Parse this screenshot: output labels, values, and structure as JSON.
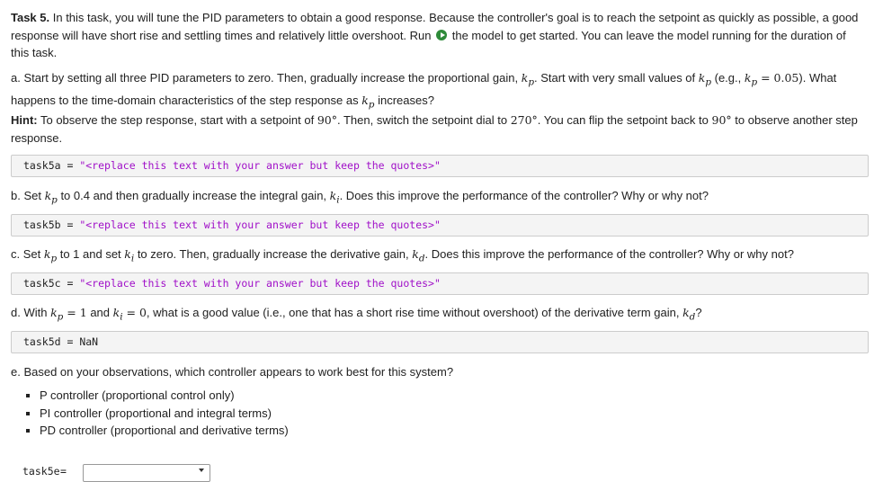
{
  "task": {
    "label": "Task 5.",
    "intro_1": " In this task, you will tune the PID parameters to obtain a good response. Because the controller's goal is to reach the setpoint as quickly as possible, a good response will have short rise and settling times and relatively little overshoot. Run ",
    "intro_2": " the model to get started. You can leave the model running for the duration of this task."
  },
  "part_a": {
    "t1": "a. Start by setting all three PID parameters to zero. Then, gradually increase the proportional gain, ",
    "t2": ". Start with very small values of ",
    "t3": " (e.g., ",
    "t4": "). What happens to the time-domain characteristics of the step response as ",
    "t5": " increases?",
    "kp_example": "k",
    "example_value": " = 0.05"
  },
  "hint": {
    "label": "Hint:",
    "t1": " To observe the step response, start with a setpoint of ",
    "setpoint_1": "90°",
    "t2": ". Then, switch the setpoint dial to ",
    "setpoint_2": "270°",
    "t3": ". You can flip the setpoint back to ",
    "setpoint_3": "90°",
    "t4": " to observe another step response."
  },
  "code_lines": {
    "task5a_name": "task5a",
    "task5a_value": "\"<replace this text with your answer but keep the quotes>\"",
    "task5b_name": "task5b",
    "task5b_value": "\"<replace this text with your answer but keep the quotes>\"",
    "task5c_name": "task5c",
    "task5c_value": "\"<replace this text with your answer but keep the quotes>\"",
    "task5d_name": "task5d",
    "task5d_value": "NaN",
    "eq": " = "
  },
  "part_b": {
    "t1": "b. Set ",
    "t2": " to 0.4 and then gradually increase the integral gain, ",
    "t3": ". Does this improve the performance of the controller? Why or why not?"
  },
  "part_c": {
    "t1": "c. Set ",
    "t2": " to 1 and set ",
    "t3": " to zero. Then, gradually increase the derivative gain, ",
    "t4": ". Does this improve the performance of the controller? Why or why not?"
  },
  "part_d": {
    "t1": "d. With ",
    "kp_eq": " = 1",
    "t2": " and ",
    "ki_eq": " = 0",
    "t3": ", what is a good value (i.e., one that has a short rise time without overshoot) of the derivative term gain, ",
    "t4": "?"
  },
  "part_e": {
    "question": "e. Based on your observations, which controller appears to work best for this system?",
    "options": [
      "P controller (proportional control only)",
      "PI controller (proportional and integral terms)",
      "PD controller (proportional and derivative terms)"
    ]
  },
  "dropdown": {
    "name": "task5e",
    "eq": " = "
  },
  "sym": {
    "k": "k",
    "p": "p",
    "i": "i",
    "d": "d"
  }
}
